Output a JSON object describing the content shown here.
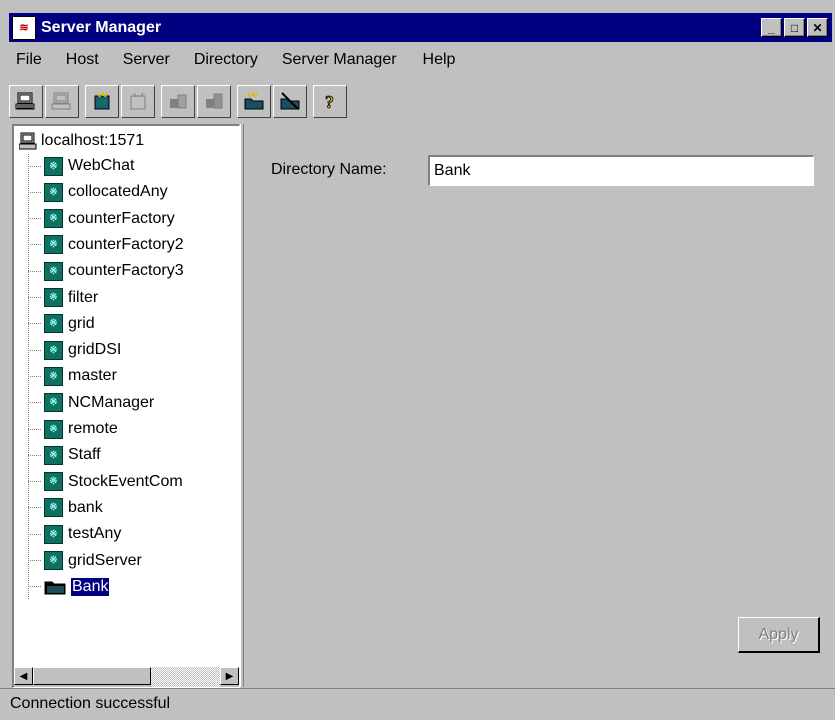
{
  "window": {
    "title": "Server Manager",
    "icon": "app-icon"
  },
  "title_controls": {
    "minimize": "_",
    "maximize": "□",
    "close": "✕"
  },
  "menubar": [
    {
      "label": "File"
    },
    {
      "label": "Host"
    },
    {
      "label": "Server"
    },
    {
      "label": "Directory"
    },
    {
      "label": "Server Manager"
    },
    {
      "label": "Help"
    }
  ],
  "toolbar": [
    {
      "icon": "host-add-icon",
      "enabled": true
    },
    {
      "icon": "host-remove-icon",
      "enabled": false
    },
    {
      "icon": "server-add-icon",
      "enabled": true
    },
    {
      "icon": "server-remove-icon",
      "enabled": false
    },
    {
      "icon": "server-start-icon",
      "enabled": false
    },
    {
      "icon": "server-stop-icon",
      "enabled": false
    },
    {
      "icon": "directory-add-icon",
      "enabled": true
    },
    {
      "icon": "directory-remove-icon",
      "enabled": true
    },
    {
      "icon": "help-icon",
      "enabled": true
    }
  ],
  "tree": {
    "root": "localhost:1571",
    "items": [
      {
        "label": "WebChat",
        "type": "server"
      },
      {
        "label": "collocatedAny",
        "type": "server"
      },
      {
        "label": "counterFactory",
        "type": "server"
      },
      {
        "label": "counterFactory2",
        "type": "server"
      },
      {
        "label": "counterFactory3",
        "type": "server"
      },
      {
        "label": "filter",
        "type": "server"
      },
      {
        "label": "grid",
        "type": "server"
      },
      {
        "label": "gridDSI",
        "type": "server"
      },
      {
        "label": "master",
        "type": "server"
      },
      {
        "label": "NCManager",
        "type": "server"
      },
      {
        "label": "remote",
        "type": "server"
      },
      {
        "label": "Staff",
        "type": "server"
      },
      {
        "label": "StockEventCom",
        "type": "server"
      },
      {
        "label": "bank",
        "type": "server"
      },
      {
        "label": "testAny",
        "type": "server"
      },
      {
        "label": "gridServer",
        "type": "server"
      },
      {
        "label": "Bank",
        "type": "directory",
        "selected": true
      }
    ]
  },
  "detail": {
    "directory_name_label": "Directory Name:",
    "directory_name_value": "Bank",
    "apply_label": "Apply"
  },
  "status": "Connection successful",
  "colors": {
    "titlebar": "#000080",
    "selection": "#000080",
    "face": "#c0c0c0"
  }
}
